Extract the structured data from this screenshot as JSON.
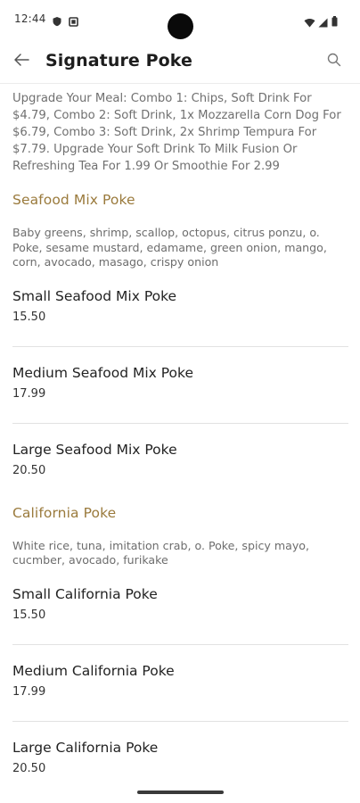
{
  "status": {
    "time": "12:44"
  },
  "appbar": {
    "title": "Signature Poke"
  },
  "promo_text": "Upgrade Your Meal: Combo 1: Chips, Soft Drink For $4.79, Combo 2: Soft Drink, 1x Mozzarella Corn Dog For $6.79, Combo 3: Soft Drink, 2x Shrimp Tempura For $7.79. Upgrade Your Soft Drink To Milk Fusion Or Refreshing Tea For 1.99 Or Smoothie For 2.99",
  "sections": [
    {
      "title": "Seafood Mix Poke",
      "description": "Baby greens, shrimp, scallop, octopus, citrus ponzu, o. Poke, sesame mustard, edamame, green onion, mango, corn, avocado, masago, crispy onion",
      "items": [
        {
          "name": "Small Seafood Mix Poke",
          "price": "15.50"
        },
        {
          "name": "Medium Seafood Mix Poke",
          "price": "17.99"
        },
        {
          "name": "Large Seafood Mix Poke",
          "price": "20.50"
        }
      ]
    },
    {
      "title": "California Poke",
      "description": "White rice, tuna, imitation crab, o. Poke, spicy mayo, cucmber, avocado, furikake",
      "items": [
        {
          "name": "Small California Poke",
          "price": "15.50"
        },
        {
          "name": "Medium California Poke",
          "price": "17.99"
        },
        {
          "name": "Large California Poke",
          "price": "20.50"
        }
      ]
    }
  ],
  "colors": {
    "section_title": "#9a7a3c",
    "divider": "#e2e2e2",
    "background": "#ffffff"
  },
  "icons": {
    "back": "arrow-left-icon",
    "search": "search-icon"
  }
}
